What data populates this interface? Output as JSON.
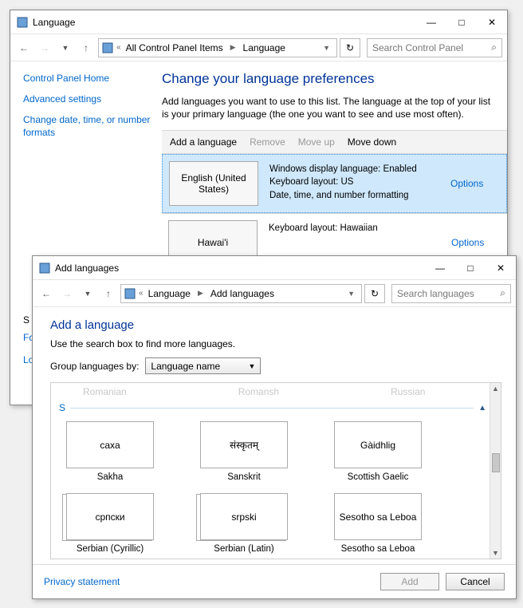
{
  "win1": {
    "title": "Language",
    "breadcrumbs": [
      "All Control Panel Items",
      "Language"
    ],
    "search_placeholder": "Search Control Panel",
    "sidebar": {
      "home": "Control Panel Home",
      "advanced": "Advanced settings",
      "datetime": "Change date, time, or number formats",
      "seealso": "S",
      "items_cut": [
        "Fo",
        "Lo"
      ]
    },
    "heading": "Change your language preferences",
    "description": "Add languages you want to use to this list. The language at the top of your list is your primary language (the one you want to see and use most often).",
    "toolbar": {
      "add": "Add a language",
      "remove": "Remove",
      "moveup": "Move up",
      "movedown": "Move down"
    },
    "rows": [
      {
        "tile": "English (United States)",
        "info": [
          "Windows display language: Enabled",
          "Keyboard layout: US",
          "Date, time, and number formatting"
        ],
        "options": "Options",
        "selected": true
      },
      {
        "tile": "Hawai'i",
        "info": [
          "Keyboard layout: Hawaiian"
        ],
        "options": "Options",
        "selected": false
      }
    ]
  },
  "win2": {
    "title": "Add languages",
    "breadcrumbs": [
      "Language",
      "Add languages"
    ],
    "search_placeholder": "Search languages",
    "heading": "Add a language",
    "sub": "Use the search box to find more languages.",
    "group_label": "Group languages by:",
    "group_value": "Language name",
    "top_peek": [
      "Romanian",
      "Romansh",
      "Russian"
    ],
    "group_letter": "S",
    "tiles": [
      {
        "native": "caxa",
        "label": "Sakha",
        "stack": false
      },
      {
        "native": "संस्कृतम्",
        "label": "Sanskrit",
        "stack": false
      },
      {
        "native": "Gàidhlig",
        "label": "Scottish Gaelic",
        "stack": false
      },
      {
        "native": "српски",
        "label": "Serbian (Cyrillic)",
        "stack": true
      },
      {
        "native": "srpski",
        "label": "Serbian (Latin)",
        "stack": true
      },
      {
        "native": "Sesotho sa Leboa",
        "label": "Sesotho sa Leboa",
        "stack": false
      }
    ],
    "privacy": "Privacy statement",
    "add_btn": "Add",
    "cancel_btn": "Cancel"
  }
}
